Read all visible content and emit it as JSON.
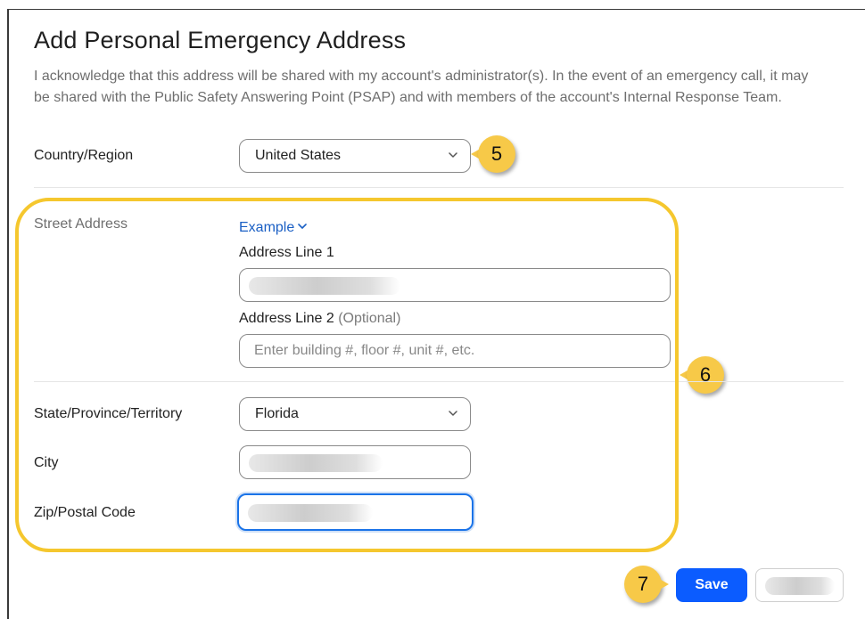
{
  "header": {
    "title": "Add Personal Emergency Address",
    "description": "I acknowledge that this address will be shared with my account's administrator(s). In the event of an emergency call, it may be shared with the Public Safety Answering Point (PSAP) and with members of the account's Internal Response Team."
  },
  "form": {
    "country_label": "Country/Region",
    "country_value": "United States",
    "street_label": "Street Address",
    "example_link": "Example",
    "address_line1_label": "Address Line 1",
    "address_line2_label": "Address Line 2",
    "address_line2_optional": "(Optional)",
    "address_line2_placeholder": "Enter building #, floor #, unit #, etc.",
    "state_label": "State/Province/Territory",
    "state_value": "Florida",
    "city_label": "City",
    "zip_label": "Zip/Postal Code"
  },
  "callouts": [
    "5",
    "6",
    "7"
  ],
  "buttons": {
    "save_label": "Save"
  },
  "colors": {
    "accent": "#0b5cff",
    "link": "#1a5fc4",
    "highlight": "#f5c72e",
    "callout": "#f7c948"
  }
}
